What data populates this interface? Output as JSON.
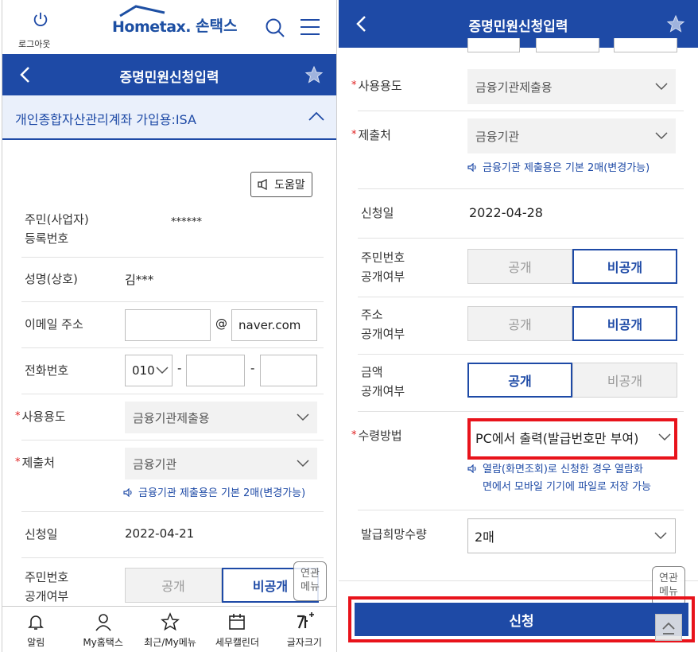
{
  "left": {
    "header": {
      "logout_label": "로그아웃",
      "logo_home": "Hometax.",
      "logo_son": "손택스"
    },
    "titlebar": {
      "title": "증명민원신청입력"
    },
    "section": {
      "title": "개인종합자산관리계좌 가입용:ISA"
    },
    "help_label": "도움말",
    "resident_label_1": "주민(사업자)",
    "resident_label_2": "등록번호",
    "resident_value": "******",
    "name_label": "성명(상호)",
    "name_value": "김***",
    "email_label": "이메일 주소",
    "email_at": "@",
    "email_domain": "naver.com",
    "phone_label": "전화번호",
    "phone_prefix": "010",
    "phone_dash": "-",
    "usage_label": "사용용도",
    "usage_value": "금융기관제출용",
    "submit_to_label": "제출처",
    "submit_to_value": "금융기관",
    "note": "금융기관 제출용은 기본 2매(변경가능)",
    "date_label": "신청일",
    "date_value": "2022-04-21",
    "rrn_disclose_label_1": "주민번호",
    "rrn_disclose_label_2": "공개여부",
    "public": "공개",
    "private": "비공개",
    "related_menu_1": "연관",
    "related_menu_2": "메뉴",
    "nav": [
      "알림",
      "My홈택스",
      "최근/My메뉴",
      "세무캘린더",
      "글자크기"
    ]
  },
  "right": {
    "titlebar": {
      "title": "증명민원신청입력"
    },
    "usage_label": "사용용도",
    "usage_value": "금융기관제출용",
    "submit_to_label": "제출처",
    "submit_to_value": "금융기관",
    "note": "금융기관 제출용은 기본 2매(변경가능)",
    "date_label": "신청일",
    "date_value": "2022-04-28",
    "rrn_label_1": "주민번호",
    "rrn_label_2": "공개여부",
    "addr_label_1": "주소",
    "addr_label_2": "공개여부",
    "amount_label_1": "금액",
    "amount_label_2": "공개여부",
    "public": "공개",
    "private": "비공개",
    "receive_label": "수령방법",
    "receive_value": "PC에서 출력(발급번호만 부여)",
    "receive_note_1": "열람(화면조회)로 신청한 경우 열람화",
    "receive_note_2": "면에서 모바일 기기에 파일로 저장 가능",
    "copies_label": "발급희망수량",
    "copies_value": "2매",
    "related_menu_1": "연관",
    "related_menu_2": "메뉴",
    "submit_label": "신청"
  },
  "colors": {
    "brand": "#1e4aa6",
    "required": "#e02020",
    "highlight": "#e8131b"
  }
}
